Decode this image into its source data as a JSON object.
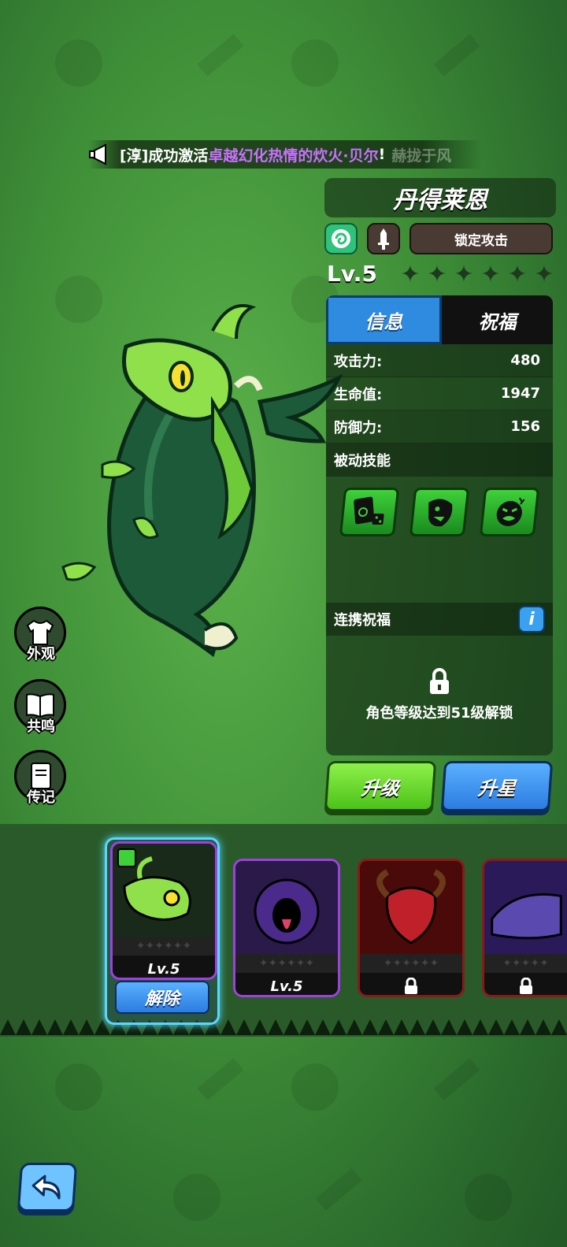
{
  "broadcast": {
    "prefix": "[淳]成功激活",
    "highlight": "卓越幻化热情的炊火·贝尔",
    "suffix": "!",
    "ghost": "赫拢于风"
  },
  "hero": {
    "name": "丹得莱恩",
    "lock_attack_label": "锁定攻击",
    "level": "Lv.5",
    "stars_total": 6,
    "stars_filled": 0
  },
  "tabs": [
    {
      "label": "信息",
      "active": true
    },
    {
      "label": "祝福",
      "active": false
    }
  ],
  "stats": [
    {
      "label": "攻击力:",
      "value": "480"
    },
    {
      "label": "生命值:",
      "value": "1947"
    },
    {
      "label": "防御力:",
      "value": "156"
    }
  ],
  "passive": {
    "title": "被动技能",
    "skills": [
      "card-dice-skill-icon",
      "monster-face-skill-icon",
      "angry-face-skill-icon"
    ]
  },
  "blessing": {
    "title": "连携祝福",
    "info_label": "i",
    "locked_text": "角色等级达到51级解锁"
  },
  "actions": {
    "upgrade": "升级",
    "star_up": "升星"
  },
  "side_menu": [
    {
      "label": "外观",
      "icon": "shirt-icon"
    },
    {
      "label": "共鸣",
      "icon": "book-icon"
    },
    {
      "label": "传记",
      "icon": "notebook-icon"
    }
  ],
  "roster": {
    "cards": [
      {
        "name": "green-dragon",
        "level": "Lv.5",
        "border": "#58d8ff",
        "locked": false
      },
      {
        "name": "purple-beast",
        "level": "Lv.5",
        "border": "#a040e0",
        "locked": false
      },
      {
        "name": "red-demon",
        "level": "",
        "border": "#8a1a1a",
        "locked": true
      },
      {
        "name": "dark-dragon",
        "level": "",
        "border": "#8a1a1a",
        "locked": true
      }
    ],
    "unequip_label": "解除"
  },
  "colors": {
    "accent_blue": "#2f8be0",
    "accent_green": "#4cc21a",
    "highlight_purple": "#c970ff"
  }
}
